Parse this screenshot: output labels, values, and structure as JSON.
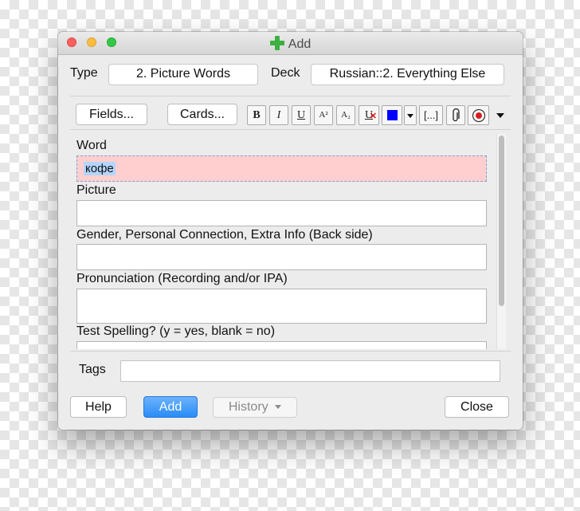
{
  "window": {
    "title": "Add"
  },
  "header": {
    "type_label": "Type",
    "type_value": "2. Picture Words",
    "deck_label": "Deck",
    "deck_value": "Russian::2. Everything Else"
  },
  "toolbar": {
    "fields_button": "Fields...",
    "cards_button": "Cards...",
    "bold": "B",
    "italic": "I",
    "underline": "U",
    "superscript": "A²",
    "subscript": "A₂",
    "clear_format": "U",
    "color_swatch": "#0000ff",
    "cloze": "[...]"
  },
  "fields": [
    {
      "label": "Word",
      "value": "кофе"
    },
    {
      "label": "Picture",
      "value": ""
    },
    {
      "label": "Gender, Personal Connection, Extra Info (Back side)",
      "value": ""
    },
    {
      "label": "Pronunciation (Recording and/or IPA)",
      "value": ""
    },
    {
      "label": "Test Spelling? (y = yes, blank = no)",
      "value": ""
    }
  ],
  "tags": {
    "label": "Tags",
    "value": ""
  },
  "footer": {
    "help": "Help",
    "add": "Add",
    "history": "History",
    "close": "Close"
  },
  "colors": {
    "active_field": "#ffcfcf",
    "primary_button": "#2a8cf7",
    "add_icon": "#3cb043"
  }
}
